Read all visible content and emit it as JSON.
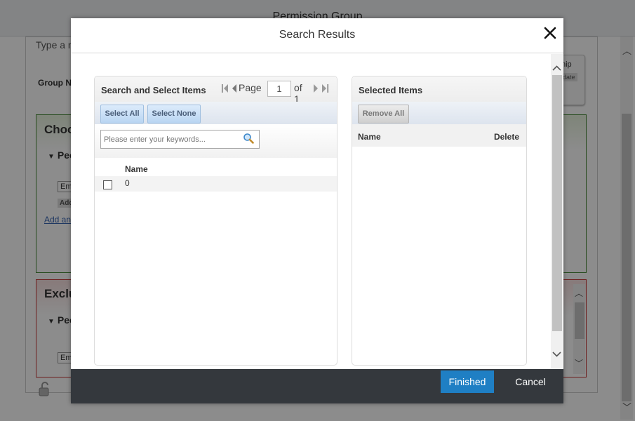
{
  "background": {
    "title": "Permission Group",
    "hint": "Type a n",
    "group_label": "Group N",
    "right_card_text": "hip",
    "right_card_button": "pdate",
    "choose_title": "Choo",
    "people_label": "Peo",
    "field_value": "Em",
    "add_button": "Add",
    "add_link": "Add and",
    "exclude_title": "Exclu",
    "people_label_2": "Peo",
    "field_value_2": "Em"
  },
  "modal": {
    "title": "Search Results",
    "left": {
      "title": "Search and Select Items",
      "pager": {
        "page_label": "Page",
        "page_value": "1",
        "of_label": "of 1"
      },
      "select_all": "Select All",
      "select_none": "Select None",
      "search_placeholder": "Please enter your keywords...",
      "column_name": "Name",
      "rows": [
        {
          "name": "0",
          "checked": false
        }
      ]
    },
    "right": {
      "title": "Selected Items",
      "remove_all": "Remove All",
      "column_name": "Name",
      "column_delete": "Delete"
    },
    "footer": {
      "finished": "Finished",
      "cancel": "Cancel"
    },
    "colors": {
      "primary": "#1f7fc4",
      "footer": "#34383d"
    }
  }
}
